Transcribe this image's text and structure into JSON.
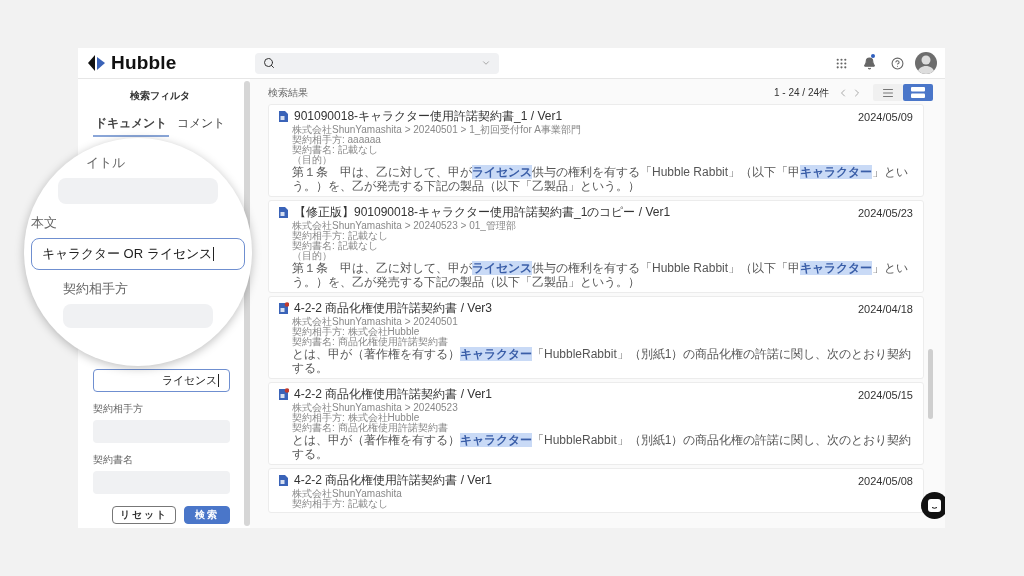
{
  "app": {
    "logo": "Hubble",
    "notifications": {
      "unread": true
    }
  },
  "sidebar": {
    "title": "検索フィルタ",
    "tabs": [
      {
        "label": "ドキュメント",
        "selected": true
      },
      {
        "label": "コメント",
        "selected": false
      }
    ],
    "fields": [
      {
        "value": "ライセンス",
        "focused": true
      },
      {
        "label": "契約相手方",
        "focused": false
      },
      {
        "label": "契約書名",
        "focused": false
      }
    ],
    "buttons": [
      {
        "label": "リセット",
        "kind": "secondary"
      },
      {
        "label": "検索",
        "kind": "primary"
      }
    ]
  },
  "magnifier": {
    "fields": [
      {
        "label": "イトル",
        "focused": false
      },
      {
        "label": "本文",
        "value": "キャラクター OR ライセンス",
        "focused": true
      },
      {
        "label": "契約相手方",
        "focused": false
      }
    ]
  },
  "results": {
    "heading": "検索結果",
    "range": "1 - 24 / 24件",
    "views": [
      {
        "kind": "list",
        "selected": false
      },
      {
        "kind": "card",
        "selected": true
      }
    ],
    "items": [
      {
        "kind": "doc",
        "title": "901090018-キャラクター使用許諾契約書_1 / Ver1",
        "date": "2024/05/09",
        "lines": [
          "株式会社ShunYamashita > 20240501 > 1_初回受付for A事業部門",
          "契約相手方: aaaaaa",
          "契約書名: 記載なし",
          "（目的）"
        ],
        "snippet": [
          {
            "text": "第１条　甲は、乙に対して、甲が",
            "highlight": false
          },
          {
            "text": "ライセンス",
            "highlight": true
          },
          {
            "text": "供与の権利を有する「Hubble Rabbit」（以下「甲",
            "highlight": false
          },
          {
            "text": "キャラクター",
            "highlight": true
          },
          {
            "text": "」という。）を、乙が発売する下記の製品（以下「乙製品」という。）",
            "highlight": false
          }
        ]
      },
      {
        "kind": "doc",
        "title": "【修正版】901090018-キャラクター使用許諾契約書_1のコピー / Ver1",
        "date": "2024/05/23",
        "lines": [
          "株式会社ShunYamashita > 20240523 > 01_管理部",
          "契約相手方: 記載なし",
          "契約書名: 記載なし",
          "（目的）"
        ],
        "snippet": [
          {
            "text": "第１条　甲は、乙に対して、甲が",
            "highlight": false
          },
          {
            "text": "ライセンス",
            "highlight": true
          },
          {
            "text": "供与の権利を有する「Hubble Rabbit」（以下「甲",
            "highlight": false
          },
          {
            "text": "キャラクター",
            "highlight": true
          },
          {
            "text": "」という。）を、乙が発売する下記の製品（以下「乙製品」という。）",
            "highlight": false
          }
        ]
      },
      {
        "kind": "doc-flagged",
        "title": "4-2-2 商品化権使用許諾契約書 / Ver3",
        "date": "2024/04/18",
        "lines": [
          "株式会社ShunYamashita > 20240501",
          "契約相手方: 株式会社Hubble",
          "契約書名: 商品化権使用許諾契約書"
        ],
        "snippet": [
          {
            "text": "とは、甲が（著作権を有する）",
            "highlight": false
          },
          {
            "text": "キャラクター",
            "highlight": true
          },
          {
            "text": "「HubbleRabbit」（別紙1）の商品化権の許諾に関し、次のとおり契約する。",
            "highlight": false
          }
        ]
      },
      {
        "kind": "doc-flagged",
        "title": "4-2-2 商品化権使用許諾契約書 / Ver1",
        "date": "2024/05/15",
        "lines": [
          "株式会社ShunYamashita > 20240523",
          "契約相手方: 株式会社Hubble",
          "契約書名: 商品化権使用許諾契約書"
        ],
        "snippet": [
          {
            "text": "とは、甲が（著作権を有する）",
            "highlight": false
          },
          {
            "text": "キャラクター",
            "highlight": true
          },
          {
            "text": "「HubbleRabbit」（別紙1）の商品化権の許諾に関し、次のとおり契約する。",
            "highlight": false
          }
        ]
      },
      {
        "kind": "doc",
        "title": "4-2-2 商品化権使用許諾契約書 / Ver1",
        "date": "2024/05/08",
        "lines": [
          "株式会社ShunYamashita",
          "契約相手方: 記載なし"
        ]
      }
    ]
  }
}
